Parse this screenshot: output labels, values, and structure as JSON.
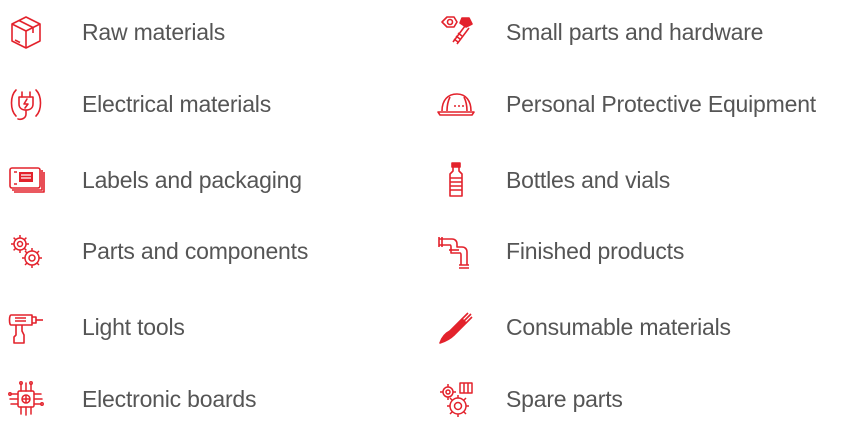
{
  "accent_color": "#e3222c",
  "text_color": "#555555",
  "categories_left": [
    {
      "label": "Raw materials",
      "icon": "box-icon"
    },
    {
      "label": "Electrical materials",
      "icon": "plug-icon"
    },
    {
      "label": "Labels and packaging",
      "icon": "labels-icon"
    },
    {
      "label": "Parts and components",
      "icon": "gears-icon"
    },
    {
      "label": "Light tools",
      "icon": "drill-icon"
    },
    {
      "label": "Electronic boards",
      "icon": "chip-icon"
    }
  ],
  "categories_right": [
    {
      "label": "Small parts and hardware",
      "icon": "nut-bolt-icon"
    },
    {
      "label": "Personal Protective Equipment",
      "icon": "helmet-icon"
    },
    {
      "label": "Bottles and vials",
      "icon": "bottle-icon"
    },
    {
      "label": "Finished products",
      "icon": "pipe-icon"
    },
    {
      "label": "Consumable materials",
      "icon": "brush-icon"
    },
    {
      "label": "Spare parts",
      "icon": "spare-gears-icon"
    }
  ]
}
